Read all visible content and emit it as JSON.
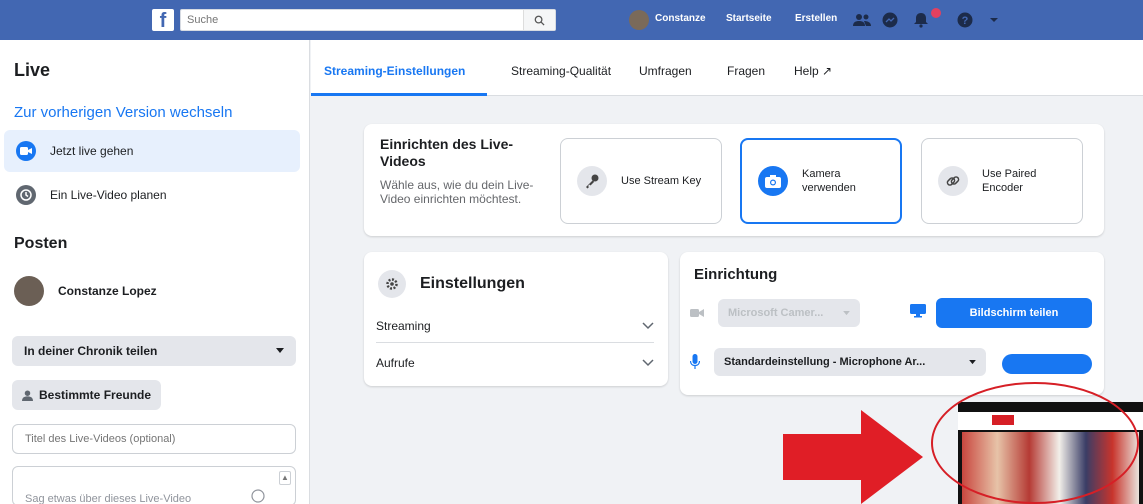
{
  "topbar": {
    "brand": "f",
    "search_placeholder": "Suche",
    "user": "Constanze",
    "home": "Startseite",
    "create": "Erstellen",
    "colors": {
      "bar": "#4267b2"
    }
  },
  "sidebar": {
    "title": "Live",
    "switch_link": "Zur vorherigen Version wechseln",
    "items": [
      {
        "label": "Jetzt live gehen",
        "icon": "video-camera-icon"
      },
      {
        "label": "Ein Live-Video planen",
        "icon": "clock-icon"
      }
    ],
    "posten_heading": "Posten",
    "user_name": "Constanze Lopez",
    "share_select": "In deiner Chronik teilen",
    "friends_button": "Bestimmte Freunde",
    "title_placeholder": "Titel des Live-Videos (optional)",
    "description_placeholder": "Sag etwas über dieses Live-Video"
  },
  "tabs": [
    {
      "label": "Streaming-Einstellungen",
      "active": true
    },
    {
      "label": "Streaming-Qualität"
    },
    {
      "label": "Umfragen"
    },
    {
      "label": "Fragen"
    },
    {
      "label": "Help ↗"
    }
  ],
  "setup": {
    "title": "Einrichten des Live-Videos",
    "subtitle": "Wähle aus, wie du dein Live-Video einrichten möchtest.",
    "options": [
      {
        "label": "Use Stream Key",
        "icon": "key-icon"
      },
      {
        "label": "Kamera verwenden",
        "icon": "camera-icon",
        "selected": true
      },
      {
        "label": "Use Paired Encoder",
        "icon": "link-icon"
      }
    ]
  },
  "settings": {
    "title": "Einstellungen",
    "rows": [
      "Streaming",
      "Aufrufe"
    ]
  },
  "einrichtung": {
    "title": "Einrichtung",
    "camera_select": "Microsoft Camer...",
    "share_screen_button": "Bildschirm teilen",
    "mic_select": "Standardeinstellung - Microphone Ar..."
  },
  "accent": "#1877f2"
}
